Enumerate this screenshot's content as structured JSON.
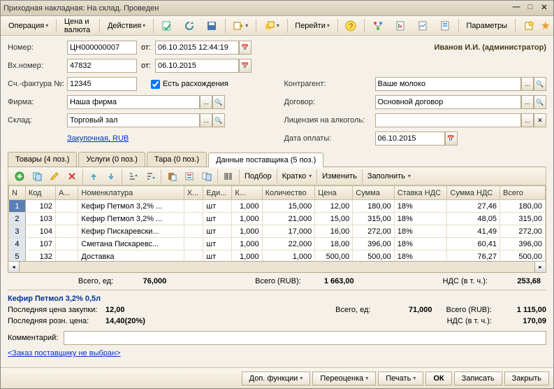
{
  "window": {
    "title": "Приходная накладная: На склад. Проведен"
  },
  "toolbar": {
    "operation": "Операция",
    "price": "Цена и валюта",
    "actions": "Действия",
    "goto": "Перейти",
    "params": "Параметры"
  },
  "user": "Иванов И.И. (администратор)",
  "form": {
    "number_label": "Номер:",
    "number": "ЦН000000007",
    "ot": "от:",
    "datetime": "06.10.2015 12:44:19",
    "inumber_label": "Вх.номер:",
    "inumber": "47832",
    "idate": "06.10.2015",
    "invoice_label": "Сч.-фактура №:",
    "invoice": "12345",
    "discrepancy": "Есть расхождения",
    "firm_label": "Фирма:",
    "firm": "Наша фирма",
    "warehouse_label": "Склад:",
    "warehouse": "Торговый зал",
    "currency_link": "Закупочная, RUB",
    "counterparty_label": "Контрагент:",
    "counterparty": "Ваше молоко",
    "contract_label": "Договор:",
    "contract": "Основной договор",
    "license_label": "Лицензия на алкоголь:",
    "license": "",
    "paydate_label": "Дата оплаты:",
    "paydate": "06.10.2015"
  },
  "tabs": [
    "Товары (4 поз.)",
    "Услуги (0 поз.)",
    "Тара (0 поз.)",
    "Данные поставщика (5 поз.)"
  ],
  "grid_toolbar": {
    "selection": "Подбор",
    "brief": "Кратко",
    "change": "Изменить",
    "fill": "Заполнить"
  },
  "columns": [
    "N",
    "Код",
    "А...",
    "Номенклатура",
    "Х...",
    "Еди...",
    "К...",
    "Количество",
    "Цена",
    "Сумма",
    "Ставка НДС",
    "Сумма НДС",
    "Всего"
  ],
  "rows": [
    {
      "n": "1",
      "code": "102",
      "art": "",
      "name": "Кефир Петмол 3,2% ...",
      "x": "",
      "unit": "шт",
      "k": "1,000",
      "qty": "15,000",
      "price": "12,00",
      "sum": "180,00",
      "vat_rate": "18%",
      "vat_sum": "27,46",
      "total": "180,00"
    },
    {
      "n": "2",
      "code": "103",
      "art": "",
      "name": "Кефир Петмол 3,2% ...",
      "x": "",
      "unit": "шт",
      "k": "1,000",
      "qty": "21,000",
      "price": "15,00",
      "sum": "315,00",
      "vat_rate": "18%",
      "vat_sum": "48,05",
      "total": "315,00"
    },
    {
      "n": "3",
      "code": "104",
      "art": "",
      "name": "Кефир Пискаревски...",
      "x": "",
      "unit": "шт",
      "k": "1,000",
      "qty": "17,000",
      "price": "16,00",
      "sum": "272,00",
      "vat_rate": "18%",
      "vat_sum": "41,49",
      "total": "272,00"
    },
    {
      "n": "4",
      "code": "107",
      "art": "",
      "name": "Сметана Пискаревс...",
      "x": "",
      "unit": "шт",
      "k": "1,000",
      "qty": "22,000",
      "price": "18,00",
      "sum": "396,00",
      "vat_rate": "18%",
      "vat_sum": "60,41",
      "total": "396,00"
    },
    {
      "n": "5",
      "code": "132",
      "art": "",
      "name": "Доставка",
      "x": "",
      "unit": "шт",
      "k": "1,000",
      "qty": "1,000",
      "price": "500,00",
      "sum": "500,00",
      "vat_rate": "18%",
      "vat_sum": "76,27",
      "total": "500,00"
    }
  ],
  "totals1": {
    "qty_label": "Всего, ед:",
    "qty": "76,000",
    "sum_label": "Всего (RUB):",
    "sum": "1 663,00",
    "vat_label": "НДС (в т. ч.):",
    "vat": "253,68"
  },
  "product": {
    "name": "Кефир Петмол 3,2% 0,5л",
    "last_buy_label": "Последняя цена закупки:",
    "last_buy": "12,00",
    "last_retail_label": "Последняя розн. цена:",
    "last_retail": "14,40(20%)"
  },
  "totals2": {
    "qty_label": "Всего, ед:",
    "qty": "71,000",
    "sum_label": "Всего (RUB):",
    "sum": "1 115,00",
    "vat_label": "НДС (в т. ч.):",
    "vat": "170,09"
  },
  "comment_label": "Комментарий:",
  "footer_link": "<Заказ поставщику не выбран>",
  "buttons": {
    "functions": "Доп. функции",
    "revalue": "Переоценка",
    "print": "Печать",
    "ok": "ОК",
    "save": "Записать",
    "close": "Закрыть"
  }
}
